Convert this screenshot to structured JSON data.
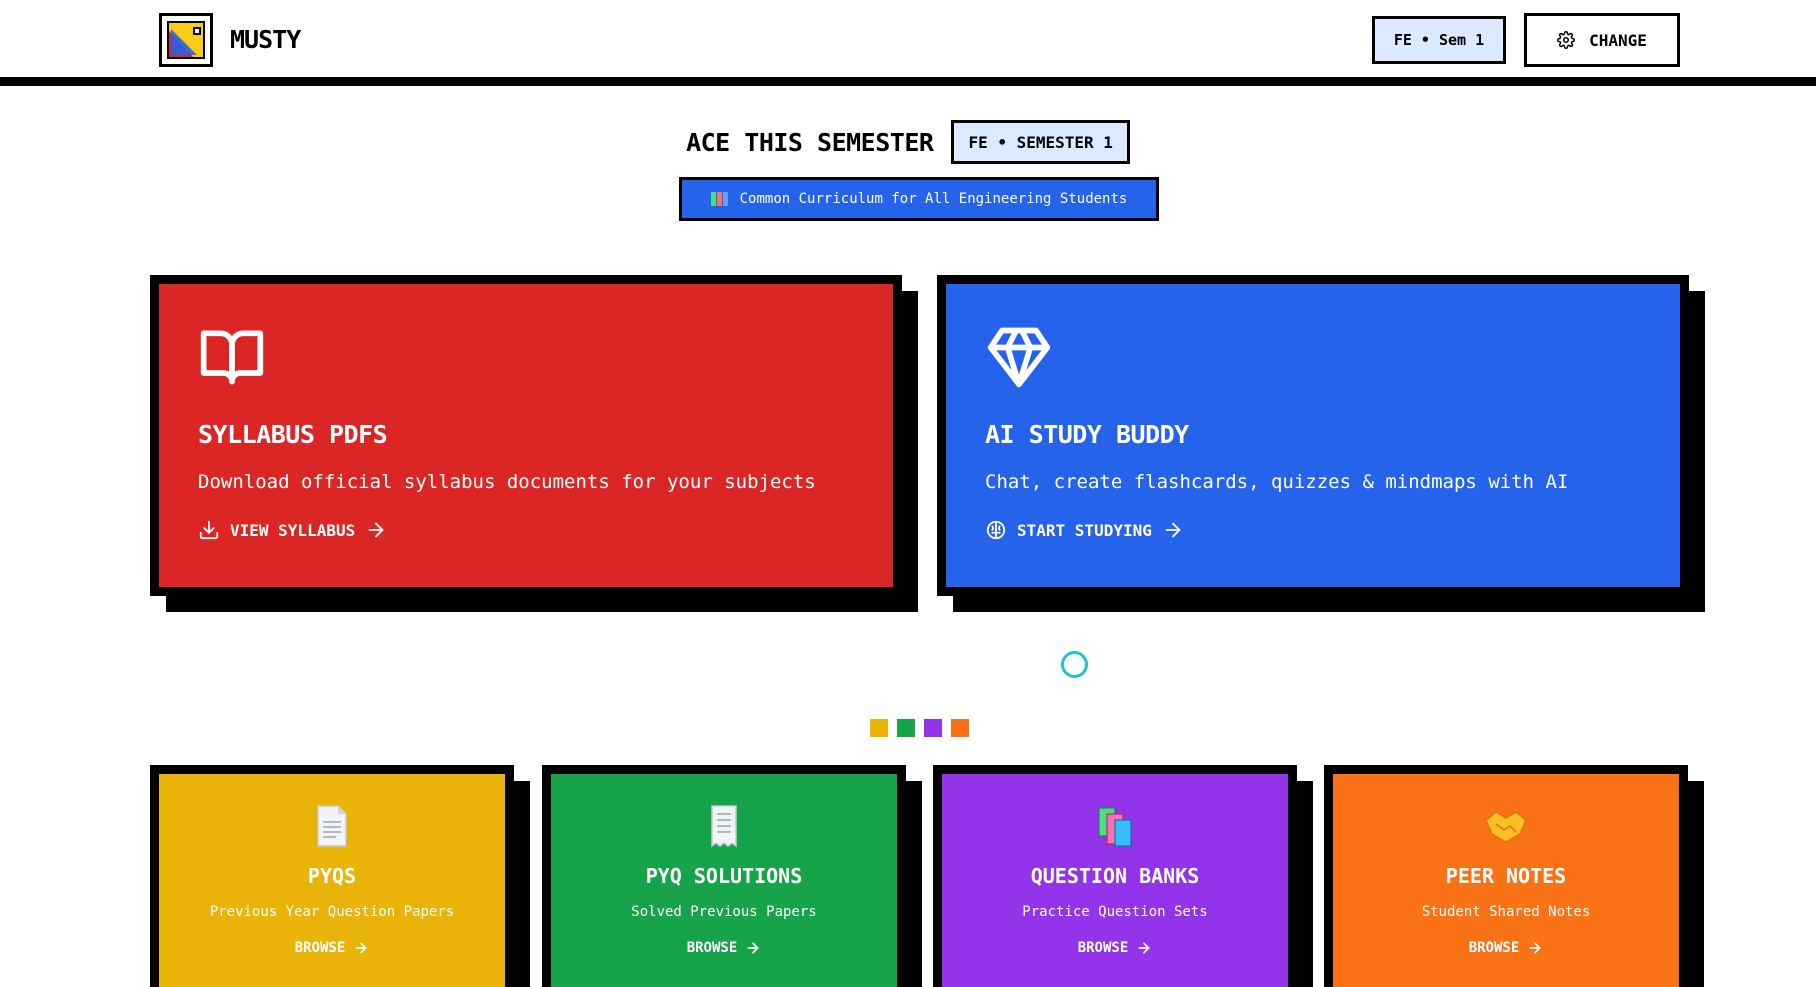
{
  "header": {
    "brand": "MUSTY",
    "semester_pill": "FE • Sem 1",
    "change_label": "CHANGE"
  },
  "hero": {
    "title": "ACE THIS SEMESTER",
    "badge": "FE • SEMESTER 1",
    "curriculum": "Common Curriculum for All Engineering Students"
  },
  "feature_cards": [
    {
      "title": "SYLLABUS PDFS",
      "description": "Download official syllabus documents for your subjects",
      "link": "VIEW SYLLABUS",
      "color": "#dc2626",
      "icon": "book-open-icon"
    },
    {
      "title": "AI STUDY BUDDY",
      "description": "Chat, create flashcards, quizzes & mindmaps with AI",
      "link": "START STUDYING",
      "color": "#2563eb",
      "icon": "diamond-icon"
    }
  ],
  "dot_colors": [
    "#eab308",
    "#16a34a",
    "#9333ea",
    "#f97316"
  ],
  "resource_cards": [
    {
      "title": "PYQS",
      "subtitle": "Previous Year Question Papers",
      "browse": "BROWSE",
      "color": "#eab308",
      "icon": "page-icon"
    },
    {
      "title": "PYQ SOLUTIONS",
      "subtitle": "Solved Previous Papers",
      "browse": "BROWSE",
      "color": "#16a34a",
      "icon": "receipt-icon"
    },
    {
      "title": "QUESTION BANKS",
      "subtitle": "Practice Question Sets",
      "browse": "BROWSE",
      "color": "#9333ea",
      "icon": "books-icon"
    },
    {
      "title": "PEER NOTES",
      "subtitle": "Student Shared Notes",
      "browse": "BROWSE",
      "color": "#f97316",
      "icon": "handshake-icon"
    }
  ]
}
